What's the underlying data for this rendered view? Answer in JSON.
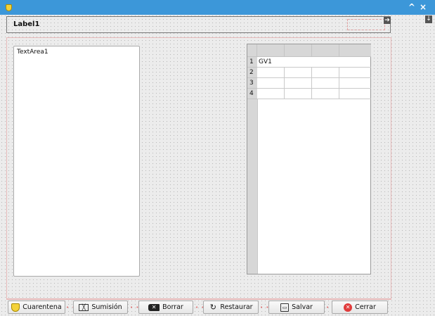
{
  "label": {
    "text": "Label1"
  },
  "textarea": {
    "text": "TextArea1"
  },
  "grid": {
    "row_numbers": [
      "1",
      "2",
      "3",
      "4"
    ],
    "first_cell": "GV1"
  },
  "buttons": {
    "cuarentena": "Cuarentena",
    "sumision": "Sumisión",
    "borrar": "Borrar",
    "restaurar": "Restaurar",
    "salvar": "Salvar",
    "cerrar": "Cerrar"
  },
  "icons": {
    "window_controls": [
      "chevron-up-icon",
      "close-icon"
    ],
    "buttons": [
      "shield-icon",
      "envelope-icon",
      "backspace-icon",
      "redo-icon",
      "floppy-disk-icon",
      "cancel-circle-icon"
    ]
  },
  "colors": {
    "titlebar": "#3c97d9",
    "accent_red": "#e03b3b"
  }
}
